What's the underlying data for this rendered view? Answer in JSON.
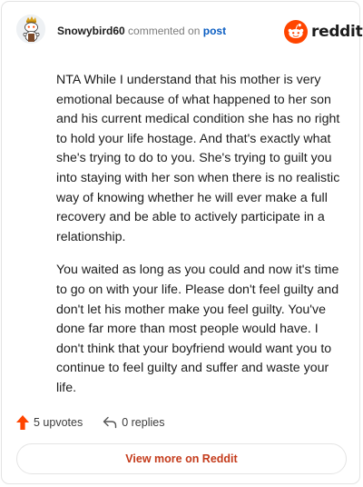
{
  "header": {
    "author": "Snowybird60",
    "verb": "commented on",
    "target": "post",
    "brand": "reddit"
  },
  "comment": {
    "paragraphs": [
      "NTA While I understand that his mother is very emotional because of what happened to her son and his current medical condition she has no right to hold your life hostage. And that's exactly what she's trying to do to you. She's trying to guilt you into staying with her son when there is no realistic way of knowing whether he will ever make a full recovery and be able to actively participate in a relationship.",
      "You waited as long as you could and now it's time to go on with your life. Please don't feel guilty and don't let his mother make you feel guilty. You've done far more than most people would have. I don't think that your boyfriend would want you to continue to feel guilty and suffer and waste your life."
    ]
  },
  "footer": {
    "upvotes": "5 upvotes",
    "replies": "0 replies",
    "view_more": "View more on Reddit"
  },
  "icons": {
    "avatar": "snoo-avatar-icon",
    "logo": "reddit-logo-icon",
    "upvote": "upvote-arrow-icon",
    "reply": "reply-arrow-icon"
  },
  "colors": {
    "brand_orange": "#ff4500",
    "upvote": "#ff4500",
    "link_blue": "#0a5dc2",
    "button_text": "#c43b1b"
  }
}
